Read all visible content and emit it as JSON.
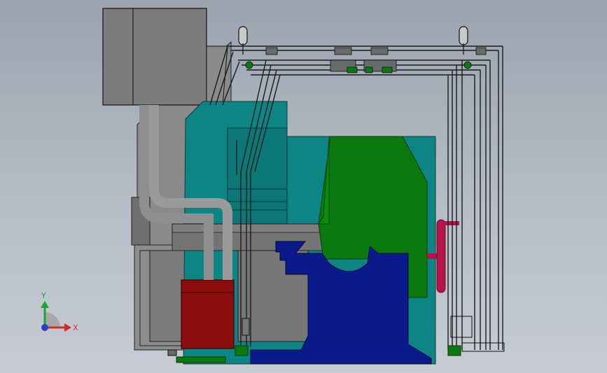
{
  "viewport": {
    "background_top": "#9aa3ae",
    "background_bottom": "#c7ccd3"
  },
  "triad": {
    "y_label": "Y",
    "x_label": "X",
    "y_color": "#1fa233",
    "x_color": "#d42a2a",
    "z_color": "#2a3fc8"
  },
  "model_colors": {
    "cabinet": "#7c7c7c",
    "teal_frame": "#0e8585",
    "green_body": "#0a7a10",
    "blue_base": "#0a1a8a",
    "red_tank": "#8a0e0e",
    "handwheel": "#b3144a",
    "frame_line": "#1a1a1a"
  }
}
